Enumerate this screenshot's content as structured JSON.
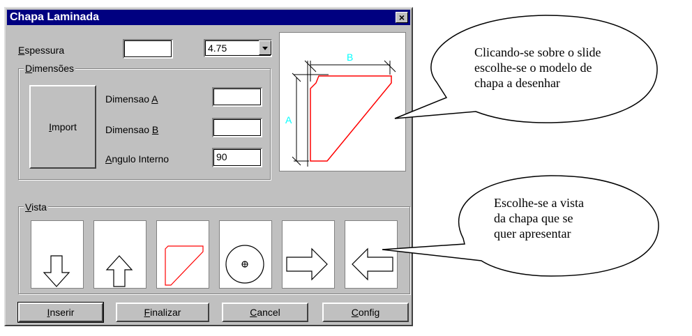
{
  "window": {
    "title": "Chapa Laminada",
    "close_label": "×"
  },
  "espessura": {
    "label_first": "E",
    "label_rest": "spessura",
    "value": "",
    "select_value": "4.75"
  },
  "dimensoes": {
    "legend_first": "D",
    "legend_rest": "imensões",
    "import_first": "I",
    "import_rest": "mport",
    "dim_a_label": "Dimensao ",
    "dim_a_key": "A",
    "dim_a_value": "",
    "dim_b_label": "Dimensao ",
    "dim_b_key": "B",
    "dim_b_value": "",
    "angulo_first": "A",
    "angulo_rest": "ngulo Interno",
    "angulo_value": "90"
  },
  "preview": {
    "label_a": "A",
    "label_b": "B"
  },
  "vista": {
    "legend_first": "V",
    "legend_rest": "ista",
    "views": [
      "arrow-down-icon",
      "arrow-up-icon",
      "plate-shape-icon",
      "circle-target-icon",
      "arrow-right-icon",
      "arrow-left-icon"
    ]
  },
  "buttons": {
    "inserir_first": "I",
    "inserir_rest": "nserir",
    "finalizar_first": "F",
    "finalizar_rest": "inalizar",
    "cancel_first": "C",
    "cancel_rest": "ancel",
    "config_first": "C",
    "config_rest": "onfig"
  },
  "callouts": {
    "top": [
      "Clicando-se sobre o slide",
      "escolhe-se o modelo de",
      "chapa a desenhar"
    ],
    "bottom": [
      "Escolhe-se a vista",
      "da chapa que se",
      "quer apresentar"
    ]
  },
  "colors": {
    "title_bg": "#000080",
    "face": "#c0c0c0",
    "plate_red": "#ff0000",
    "dim_cyan": "#00ffff"
  }
}
